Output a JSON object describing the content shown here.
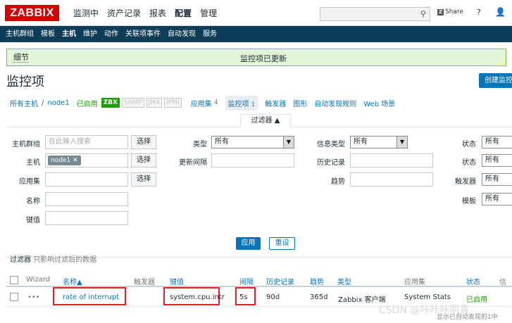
{
  "logo": "ZABBIX",
  "main_nav": [
    {
      "label": "监测中"
    },
    {
      "label": "资产记录"
    },
    {
      "label": "报表"
    },
    {
      "label": "配置"
    },
    {
      "label": "管理"
    }
  ],
  "top_right": {
    "share": "Share",
    "help": "?",
    "user": "👤"
  },
  "sub_nav": [
    {
      "label": "主机群组"
    },
    {
      "label": "模板"
    },
    {
      "label": "主机"
    },
    {
      "label": "维护"
    },
    {
      "label": "动作"
    },
    {
      "label": "关联项事件"
    },
    {
      "label": "自动发现"
    },
    {
      "label": "服务"
    }
  ],
  "message": {
    "details": "细节",
    "text": "监控项已更新"
  },
  "page_title": "监控项",
  "create_button": "创建监控项",
  "crumbs": {
    "all_hosts": "所有主机",
    "separator": "/",
    "host": "node1",
    "enabled": "已启用",
    "badges": [
      "ZBX",
      "SNMP",
      "JMX",
      "IPMI"
    ],
    "apps": "应用集",
    "apps_count": "4",
    "items": "监控项",
    "items_count": "1",
    "triggers": "触发器",
    "graphs": "图形",
    "discovery": "自动发现规则",
    "web": "Web 场景"
  },
  "filter": {
    "tab_label": "过滤器 ▲",
    "host_group_label": "主机群组",
    "host_group_placeholder": "在此输入搜索",
    "select_label": "选择",
    "host_label": "主机",
    "host_tag": "node1",
    "app_label": "应用集",
    "name_label": "名称",
    "key_label": "键值",
    "type_label": "类型",
    "type_value": "所有",
    "interval_label": "更新间隔",
    "info_type_label": "信息类型",
    "info_type_value": "所有",
    "history_label": "历史记录",
    "trends_label": "趋势",
    "state_label": "状态",
    "state_value": "所有",
    "status_label": "状态",
    "status_value": "所有",
    "triggers_label": "触发器",
    "triggers_value": "所有",
    "template_label": "模板",
    "template_value": "所有",
    "apply": "应用",
    "reset": "重设",
    "note_prefix": "过滤器",
    "note_text": "只影响过滤后的数据"
  },
  "table": {
    "headers": {
      "wizard": "Wizard",
      "name": "名称▲",
      "triggers": "触发器",
      "key": "键值",
      "interval": "间隔",
      "history": "历史记录",
      "trends": "趋势",
      "type": "类型",
      "apps": "应用集",
      "status": "状态",
      "info": "信"
    },
    "rows": [
      {
        "wizard": "•••",
        "name": "rate of interrupt",
        "key": "system.cpu.intr",
        "interval": "5s",
        "history": "90d",
        "trends": "365d",
        "type": "Zabbix 客户端",
        "app": "System Stats",
        "status": "已启用"
      }
    ]
  },
  "watermark": "CSDN @咔咔咔明青",
  "footer_cutoff": "显示已自动发现的1中"
}
